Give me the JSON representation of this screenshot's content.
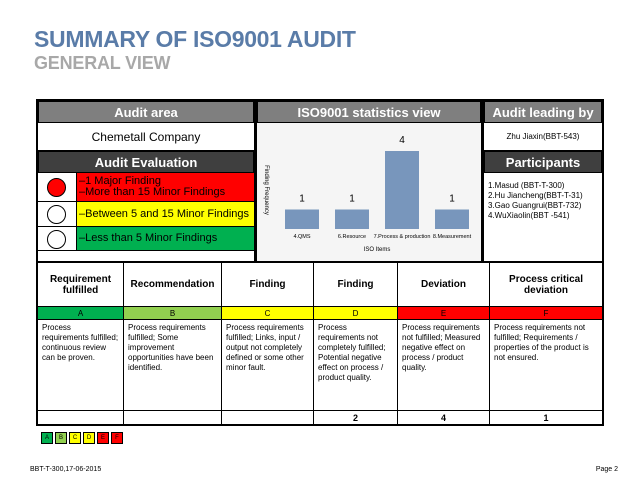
{
  "title": "SUMMARY OF ISO9001 AUDIT",
  "subtitle": "GENERAL VIEW",
  "audit_area": {
    "header": "Audit area",
    "value": "Chemetall Company"
  },
  "audit_evaluation": {
    "header": "Audit Evaluation",
    "rows": [
      {
        "lines": [
          "–1 Major Finding",
          "–More than 15 Minor Findings"
        ],
        "color": "#ff0000",
        "circle_color": "#ff0000"
      },
      {
        "lines": [
          "–Between 5 and 15 Minor Findings"
        ],
        "color": "#ffff00",
        "circle_color": "#ffffff"
      },
      {
        "lines": [
          "–Less than 5 Minor Findings"
        ],
        "color": "#00b050",
        "circle_color": "#ffffff"
      }
    ]
  },
  "stats_header": "ISO9001  statistics view",
  "chart_data": {
    "type": "bar",
    "categories": [
      "4.QMS",
      "6.Resource",
      "7.Process & production",
      "8.Measurement"
    ],
    "values": [
      1,
      1,
      4,
      1
    ],
    "xlabel": "ISO Items",
    "ylabel": "Finding Frequency",
    "ylim": [
      0,
      4
    ],
    "bar_color": "#7896bc",
    "grid": false
  },
  "audit_leading": {
    "header": "Audit  leading by",
    "value": "Zhu Jiaxin(BBT-543)"
  },
  "participants": {
    "header": "Participants",
    "items": [
      "1.Masud (BBT-T-300)",
      "2.Hu Jiancheng(BBT-T-31)",
      "3.Gao Guangrui(BBT-732)",
      "4.WuXiaolin(BBT -541)"
    ]
  },
  "table": {
    "columns": [
      {
        "header": "Requirement fulfilled",
        "code": "A",
        "color": "#00b050",
        "desc": "Process requirements fulfilled; continuous review can be proven.",
        "count": ""
      },
      {
        "header": "Recommendation",
        "code": "B",
        "color": "#92d050",
        "desc": "Process requirements fulfilled; Some improvement opportunities have been identified.",
        "count": ""
      },
      {
        "header": "Finding",
        "code": "C",
        "color": "#ffff00",
        "desc": "Process requirements fulfilled; Links, input / output not completely defined or some other minor fault.",
        "count": ""
      },
      {
        "header": "Finding",
        "code": "D",
        "color": "#ffff00",
        "desc": "Process requirements not completely fulfilled; Potential negative effect on process / product quality.",
        "count": "2"
      },
      {
        "header": "Deviation",
        "code": "E",
        "color": "#ff0000",
        "desc": "Process requirements not fulfilled; Measured negative effect on process / product quality.",
        "count": "4"
      },
      {
        "header": "Process critical deviation",
        "code": "F",
        "color": "#ff0000",
        "desc": "Process requirements not fulfilled; Requirements / properties of the product is not ensured.",
        "count": "1"
      }
    ]
  },
  "legend": [
    {
      "code": "A",
      "color": "#00b050"
    },
    {
      "code": "B",
      "color": "#92d050"
    },
    {
      "code": "C",
      "color": "#ffff00"
    },
    {
      "code": "D",
      "color": "#ffff00"
    },
    {
      "code": "E",
      "color": "#ff0000"
    },
    {
      "code": "F",
      "color": "#ff0000"
    }
  ],
  "footer": {
    "left": "BBT-T-300,17-06-2015",
    "right": "Page 2"
  }
}
